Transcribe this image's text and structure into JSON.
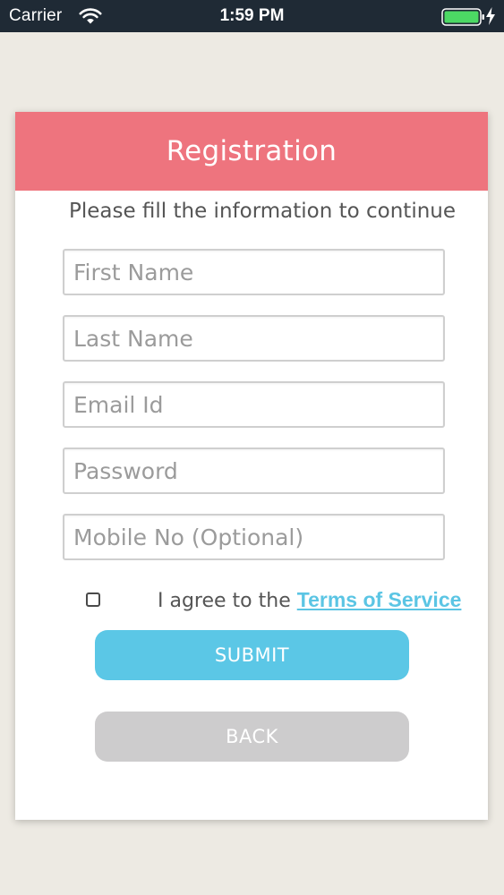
{
  "status_bar": {
    "carrier": "Carrier",
    "time": "1:59 PM",
    "icons": [
      "wifi-icon",
      "battery-icon",
      "charging-bolt-icon"
    ]
  },
  "card": {
    "header_title": "Registration",
    "subtitle": "Please fill the information to continue"
  },
  "form": {
    "first_name": {
      "placeholder": "First Name",
      "value": ""
    },
    "last_name": {
      "placeholder": "Last Name",
      "value": ""
    },
    "email": {
      "placeholder": "Email Id",
      "value": ""
    },
    "password": {
      "placeholder": "Password",
      "value": ""
    },
    "mobile": {
      "placeholder": "Mobile No (Optional)",
      "value": ""
    }
  },
  "agreement": {
    "checked": false,
    "prefix": "I agree to the ",
    "link_text": "Terms of Service"
  },
  "buttons": {
    "submit_label": "SUBMIT",
    "back_label": "BACK"
  },
  "colors": {
    "header": "#ee747e",
    "submit": "#5bc7e6",
    "back": "#cdcccd",
    "link": "#5bc5e4",
    "status_bar": "#1f2a35",
    "background": "#edeae3",
    "battery": "#4cd964"
  }
}
